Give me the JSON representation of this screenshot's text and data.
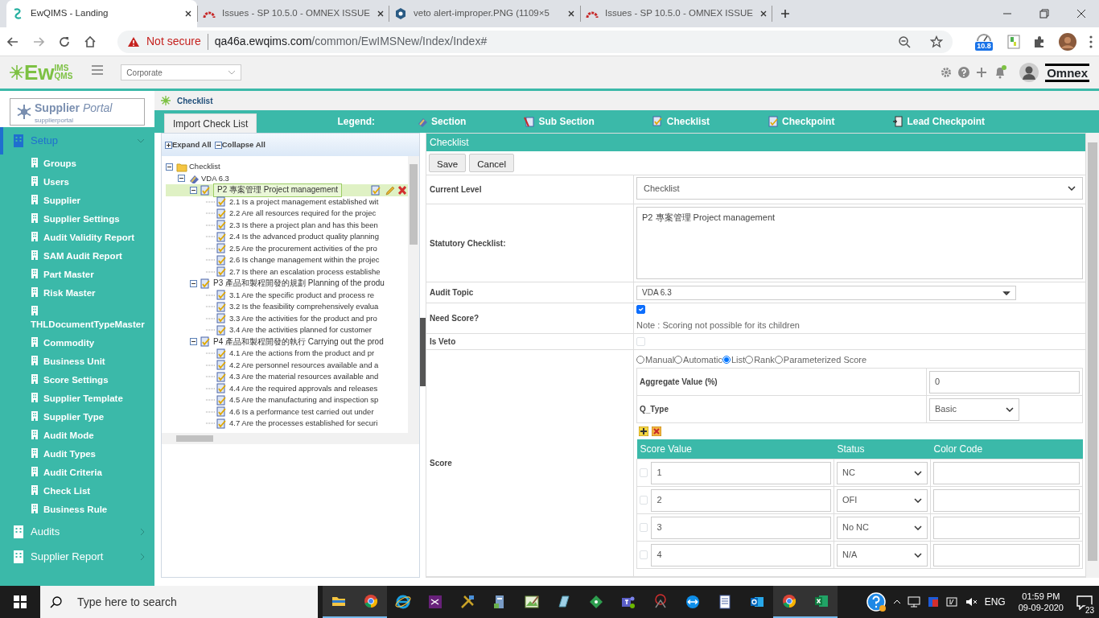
{
  "browser": {
    "tabs": [
      {
        "kind": "app",
        "title": "EwQIMS - Landing",
        "selected": true
      },
      {
        "kind": "issues",
        "title": "Issues - SP 10.5.0 - OMNEX ISSUE",
        "selected": false
      },
      {
        "kind": "image",
        "title": "veto alert-improper.PNG (1109×5",
        "selected": false
      },
      {
        "kind": "issues",
        "title": "Issues - SP 10.5.0 - OMNEX ISSUE",
        "selected": false
      }
    ],
    "security": "Not secure",
    "url_host": "qa46a.ewqims.com",
    "url_path": "/common/EwIMSNew/Index/Index#",
    "extension_badge": "10.8"
  },
  "header": {
    "logo": {
      "main": "Ew",
      "top": "IMS",
      "bottom": "QMS"
    },
    "site": "Corporate",
    "brand": "Omnex"
  },
  "sidebar": {
    "logo": {
      "title": "Supplier",
      "title_italic": "Portal",
      "subtitle": "supplierportal"
    },
    "items": [
      {
        "label": "Setup",
        "selected": true,
        "expanded": true,
        "children": [
          {
            "label": "Groups",
            "selected": false
          },
          {
            "label": "Users",
            "selected": false
          },
          {
            "label": "Supplier",
            "selected": false
          },
          {
            "label": "Supplier Settings",
            "selected": false
          },
          {
            "label": "Audit Validity Report",
            "selected": false
          },
          {
            "label": "SAM Audit Report",
            "selected": false
          },
          {
            "label": "Part Master",
            "selected": false
          },
          {
            "label": "Risk Master",
            "selected": false
          },
          {
            "label": "THLDocumentTypeMaster",
            "selected": false
          },
          {
            "label": "Commodity",
            "selected": false
          },
          {
            "label": "Business Unit",
            "selected": false
          },
          {
            "label": "Score Settings",
            "selected": false
          },
          {
            "label": "Supplier Template",
            "selected": false
          },
          {
            "label": "Supplier Type",
            "selected": false
          },
          {
            "label": "Audit Mode",
            "selected": false
          },
          {
            "label": "Audit Types",
            "selected": false
          },
          {
            "label": "Audit Criteria",
            "selected": false
          },
          {
            "label": "Check List",
            "selected": false
          },
          {
            "label": "Business Rule",
            "selected": false
          }
        ]
      },
      {
        "label": "Audits",
        "selected": false,
        "expanded": false
      },
      {
        "label": "Supplier Report",
        "selected": false,
        "expanded": false
      }
    ]
  },
  "breadcrumb": "Checklist",
  "tabs": [
    {
      "label": "Import Check List",
      "selected": true
    }
  ],
  "legend": {
    "label": "Legend:",
    "items": [
      {
        "kind": "section",
        "label": "Section"
      },
      {
        "kind": "subsection",
        "label": "Sub Section"
      },
      {
        "kind": "checklist",
        "label": "Checklist"
      },
      {
        "kind": "checkpoint",
        "label": "Checkpoint"
      },
      {
        "kind": "lead",
        "label": "Lead Checkpoint"
      }
    ]
  },
  "tree": {
    "expand_all": "Expand All",
    "collapse_all": "Collapse All",
    "nodes": [
      {
        "kind": "folder",
        "label": "Checklist",
        "expanded": true,
        "selected": false,
        "children": [
          {
            "kind": "audit",
            "label": "VDA 6.3",
            "expanded": true,
            "selected": false,
            "children": [
              {
                "kind": "checklist",
                "label": "P2 專案管理 Project management",
                "expanded": true,
                "selected": true,
                "children": [
                  {
                    "kind": "checkpoint",
                    "label": "2.1 Is a project management established wit",
                    "selected": false
                  },
                  {
                    "kind": "checkpoint",
                    "label": "2.2 Are all resources required for the projec",
                    "selected": false
                  },
                  {
                    "kind": "checkpoint",
                    "label": "2.3 Is there a project plan and has this been",
                    "selected": false
                  },
                  {
                    "kind": "checkpoint",
                    "label": "2.4 Is the advanced product quality planning",
                    "selected": false
                  },
                  {
                    "kind": "checkpoint",
                    "label": "2.5 Are the procurement activities of the pro",
                    "selected": false
                  },
                  {
                    "kind": "checkpoint",
                    "label": "2.6 Is change management within the projec",
                    "selected": false
                  },
                  {
                    "kind": "checkpoint",
                    "label": "2.7 Is there an escalation process establishe",
                    "selected": false
                  }
                ]
              },
              {
                "kind": "checklist",
                "label": "P3 產品和製程開發的規劃 Planning of the produ",
                "expanded": true,
                "selected": false,
                "children": [
                  {
                    "kind": "checkpoint",
                    "label": "3.1 Are the specific product and process re",
                    "selected": false
                  },
                  {
                    "kind": "checkpoint",
                    "label": "3.2 Is the feasibility comprehensively evalua",
                    "selected": false
                  },
                  {
                    "kind": "checkpoint",
                    "label": "3.3 Are the activities for the product and pro",
                    "selected": false
                  },
                  {
                    "kind": "checkpoint",
                    "label": "3.4 Are the activities planned for customer",
                    "selected": false
                  }
                ]
              },
              {
                "kind": "checklist",
                "label": "P4 產品和製程開發的執行 Carrying out the prod",
                "expanded": true,
                "selected": false,
                "children": [
                  {
                    "kind": "checkpoint",
                    "label": "4.1 Are the actions from the product and pr",
                    "selected": false
                  },
                  {
                    "kind": "checkpoint",
                    "label": "4.2 Are personnel resources available and a",
                    "selected": false
                  },
                  {
                    "kind": "checkpoint",
                    "label": "4.3 Are the material resources available and",
                    "selected": false
                  },
                  {
                    "kind": "checkpoint",
                    "label": "4.4 Are the required approvals and releases",
                    "selected": false
                  },
                  {
                    "kind": "checkpoint",
                    "label": "4.5 Are the manufacturing and inspection sp",
                    "selected": false
                  },
                  {
                    "kind": "checkpoint",
                    "label": "4.6 Is a performance test carried out under",
                    "selected": false
                  },
                  {
                    "kind": "checkpoint",
                    "label": "4.7 Are the processes established for securi",
                    "selected": false
                  }
                ]
              }
            ]
          }
        ]
      }
    ]
  },
  "form": {
    "title": "Checklist",
    "buttons": [
      "Save",
      "Cancel"
    ],
    "current_level": {
      "label": "Current Level",
      "value": "Checklist"
    },
    "statutory": {
      "label": "Statutory Checklist:",
      "value": "P2 專案管理 Project management"
    },
    "audit_topic": {
      "label": "Audit Topic",
      "value": "VDA 6.3"
    },
    "need_score": {
      "label": "Need Score?",
      "checked": true,
      "note": "Note : Scoring not possible for its children"
    },
    "is_veto": {
      "label": "Is Veto",
      "checked": false
    },
    "score": {
      "label": "Score",
      "methods": [
        {
          "label": "Manual",
          "selected": false
        },
        {
          "label": "Automatic",
          "selected": false
        },
        {
          "label": "List",
          "selected": true
        },
        {
          "label": "Rank",
          "selected": false
        },
        {
          "label": "Parameterized Score",
          "selected": false
        }
      ],
      "aggregate": {
        "label": "Aggregate Value (%)",
        "value": "0"
      },
      "q_type": {
        "label": "Q_Type",
        "value": "Basic"
      },
      "columns": [
        "Score Value",
        "Status",
        "Color Code"
      ],
      "rows": [
        {
          "checked": false,
          "value": "1",
          "status": "NC"
        },
        {
          "checked": false,
          "value": "2",
          "status": "OFI"
        },
        {
          "checked": false,
          "value": "3",
          "status": "No NC"
        },
        {
          "checked": false,
          "value": "4",
          "status": "N/A"
        }
      ]
    }
  },
  "taskbar": {
    "search_placeholder": "Type here to search",
    "apps": [
      {
        "kind": "folder",
        "running": true
      },
      {
        "kind": "chrome",
        "running": true
      },
      {
        "kind": "ie",
        "running": false
      },
      {
        "kind": "vs",
        "running": false
      },
      {
        "kind": "tools",
        "running": false
      },
      {
        "kind": "server",
        "running": false
      },
      {
        "kind": "paint",
        "running": false
      },
      {
        "kind": "glass",
        "running": false
      },
      {
        "kind": "diamond",
        "running": false
      },
      {
        "kind": "teams",
        "running": false
      },
      {
        "kind": "snip",
        "running": false
      },
      {
        "kind": "teamviewer",
        "running": false
      },
      {
        "kind": "doc",
        "running": false
      },
      {
        "kind": "outlook",
        "running": false
      },
      {
        "kind": "chrome",
        "running": true
      },
      {
        "kind": "excel",
        "running": true
      }
    ],
    "language": "ENG",
    "time": "01:59 PM",
    "date": "09-09-2020",
    "notifications": "23"
  }
}
